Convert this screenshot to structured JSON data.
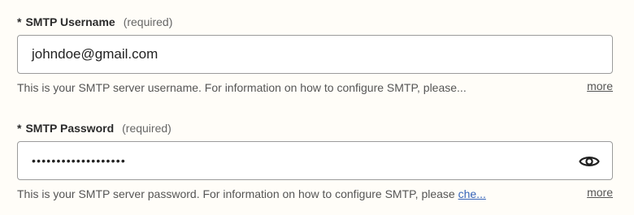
{
  "username_field": {
    "asterisk": "*",
    "label": "SMTP Username",
    "required": "(required)",
    "value": "johndoe@gmail.com",
    "help_text": "This is your SMTP server username. For information on how to configure SMTP, please...",
    "more_label": "more"
  },
  "password_field": {
    "asterisk": "*",
    "label": "SMTP Password",
    "required": "(required)",
    "masked_value": "•••••••••••••••••••",
    "help_text": "This is your SMTP server password. For information on how to configure SMTP, please ",
    "help_link": "che...",
    "more_label": "more",
    "toggle_icon": "eye-icon"
  }
}
